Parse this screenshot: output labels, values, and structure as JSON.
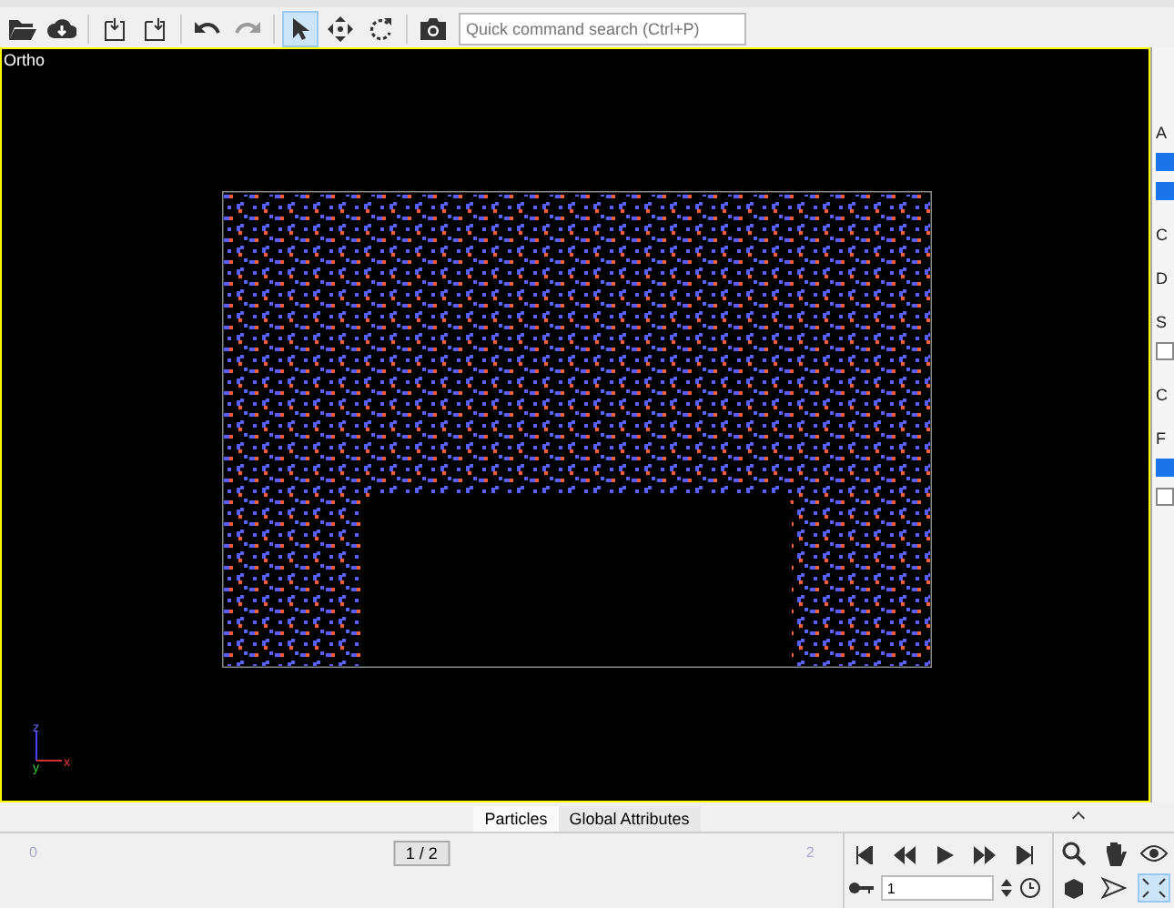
{
  "toolbar": {
    "search": {
      "placeholder": "Quick command search (Ctrl+P)"
    }
  },
  "viewport": {
    "label": "Ortho",
    "axes": [
      "z",
      "y",
      "x"
    ]
  },
  "tabs": [
    {
      "label": "Particles",
      "selected": true
    },
    {
      "label": "Global Attributes",
      "selected": false
    }
  ],
  "timeline": {
    "start": "0",
    "end": "2",
    "current": "1 / 2",
    "level": 0.5
  },
  "animation": {
    "frame": "1"
  },
  "side_panel": [
    {
      "kind": "letter",
      "text": "A"
    },
    {
      "kind": "checkbox",
      "checked": true
    },
    {
      "kind": "checkbox",
      "checked": true
    },
    {
      "kind": "letter",
      "text": "C"
    },
    {
      "kind": "letter",
      "text": "D"
    },
    {
      "kind": "letter",
      "text": "S"
    },
    {
      "kind": "checkbox",
      "checked": false
    },
    {
      "kind": "letter",
      "text": "C"
    },
    {
      "kind": "letter",
      "text": "F"
    },
    {
      "kind": "checkbox",
      "checked": true
    },
    {
      "kind": "checkbox",
      "checked": false
    }
  ]
}
